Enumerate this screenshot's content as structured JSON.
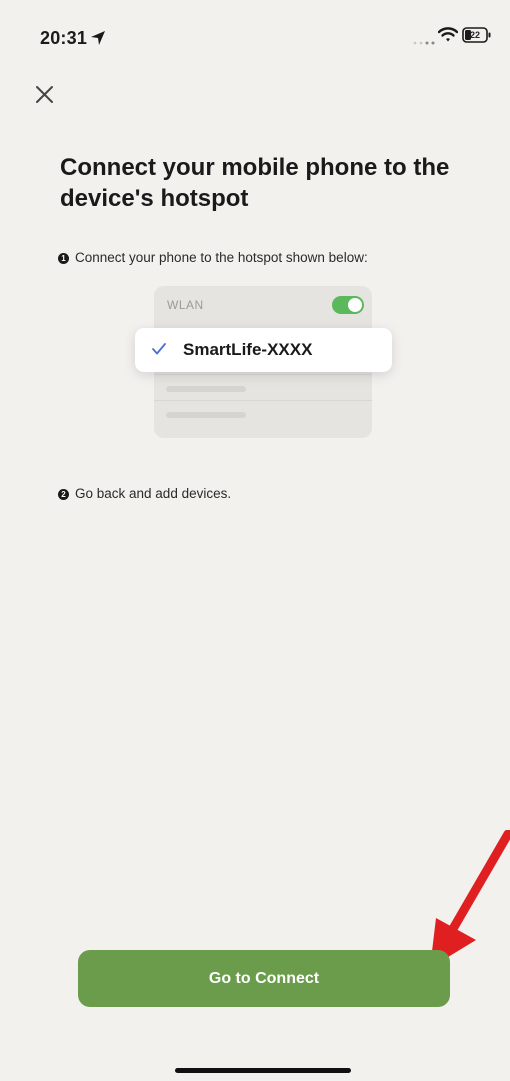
{
  "status_bar": {
    "time": "20:31",
    "battery_level": "22",
    "icons": [
      "location-arrow-icon",
      "signal-icon",
      "wifi-icon",
      "battery-icon"
    ]
  },
  "header": {
    "close_icon": "close-icon"
  },
  "main": {
    "title": "Connect your mobile phone to the device's hotspot",
    "steps": [
      {
        "number": "1",
        "text": "Connect your phone to the hotspot shown below:"
      },
      {
        "number": "2",
        "text": "Go back and add devices."
      }
    ],
    "wifi_illustration": {
      "wlan_label": "WLAN",
      "toggle_on": true,
      "network_name": "SmartLife-XXXX",
      "network_selected": true
    }
  },
  "footer": {
    "connect_label": "Go to Connect"
  },
  "colors": {
    "background": "#f3f1ee",
    "button_green": "#6a9c4c",
    "toggle_green": "#5cb85c",
    "checkmark_blue": "#4a6fd4",
    "arrow_red": "#e02020"
  }
}
